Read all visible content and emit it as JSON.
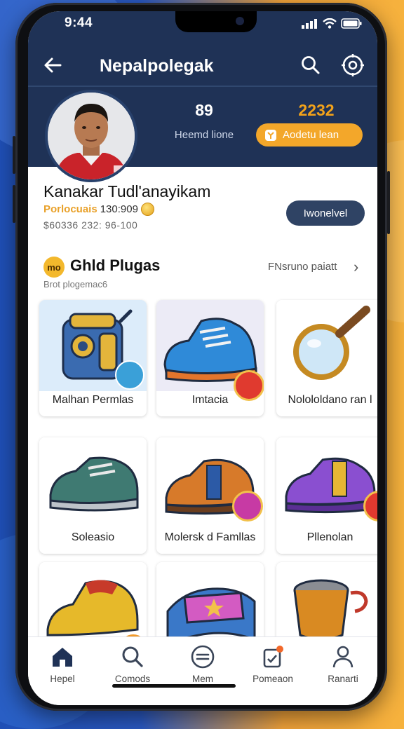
{
  "status_bar": {
    "time": "9:44"
  },
  "header": {
    "title": "Nepalpolegak"
  },
  "profile": {
    "stat_1_value": "89",
    "stat_1_label": "Heemd lione",
    "stat_2_value": "2232",
    "stat_2_button": "Aodetu lean",
    "name": "Kanakar Tudl'anayikam",
    "points_label": "Porlocuais",
    "points_value": "130:909",
    "phone": "$60336 232: 96-100",
    "action_button": "Iwonelvel"
  },
  "section": {
    "icon_text": "mo",
    "title": "Ghld Plugas",
    "subtitle": "Brot plogemac6",
    "link": "FNsruno paiatt"
  },
  "items": [
    {
      "label": "Malhan Permlas"
    },
    {
      "label": "Imtacia"
    },
    {
      "label": "Nolololdano ran l"
    },
    {
      "label": "Soleasio"
    },
    {
      "label": "Molersk d Famllas"
    },
    {
      "label": "Pllenolan"
    },
    {
      "label": ""
    },
    {
      "label": ""
    },
    {
      "label": ""
    }
  ],
  "tabbar": [
    {
      "label": "Hepel",
      "icon": "home-icon"
    },
    {
      "label": "Comods",
      "icon": "search-icon"
    },
    {
      "label": "Mem",
      "icon": "menu-icon"
    },
    {
      "label": "Pomeaon",
      "icon": "clipboard-icon"
    },
    {
      "label": "Ranarti",
      "icon": "user-icon"
    }
  ],
  "colors": {
    "header": "#1f3256",
    "accent": "#f3a72a",
    "pill": "#2f4364",
    "tab_active": "#1f3256"
  }
}
